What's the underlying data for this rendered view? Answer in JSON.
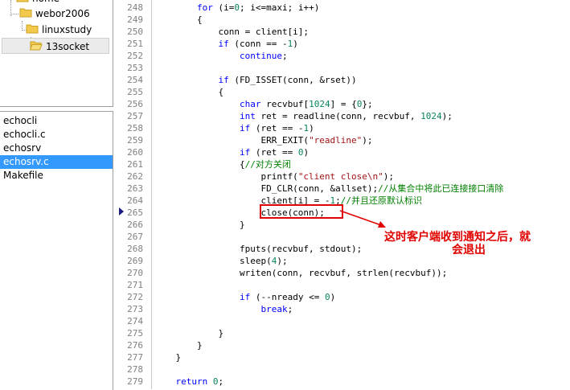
{
  "tree": {
    "items": [
      {
        "label": "home"
      },
      {
        "label": "webor2006"
      },
      {
        "label": "linuxstudy"
      },
      {
        "label": "13socket"
      }
    ]
  },
  "files": [
    {
      "label": "echocli"
    },
    {
      "label": "echocli.c"
    },
    {
      "label": "echosrv"
    },
    {
      "label": "echosrv.c"
    },
    {
      "label": "Makefile"
    }
  ],
  "colors": {
    "annotation": "#e00000",
    "selection": "#3399ff",
    "keyword": "#0000ff",
    "string": "#a31515",
    "comment": "#008000"
  },
  "line_numbers": [
    "248",
    "249",
    "250",
    "251",
    "252",
    "253",
    "254",
    "255",
    "256",
    "257",
    "258",
    "259",
    "260",
    "261",
    "262",
    "263",
    "264",
    "265",
    "266",
    "267",
    "268",
    "269",
    "270",
    "271",
    "272",
    "273",
    "274",
    "275",
    "276",
    "277",
    "278",
    "279"
  ],
  "code": [
    [
      {
        "t": "        "
      },
      {
        "t": "for",
        "c": "kw"
      },
      {
        "t": " (i="
      },
      {
        "t": "0",
        "c": "num"
      },
      {
        "t": "; i<=maxi; i++)"
      }
    ],
    [
      {
        "t": "        {"
      }
    ],
    [
      {
        "t": "            conn = client[i];"
      }
    ],
    [
      {
        "t": "            "
      },
      {
        "t": "if",
        "c": "kw"
      },
      {
        "t": " (conn == -"
      },
      {
        "t": "1",
        "c": "num"
      },
      {
        "t": ")"
      }
    ],
    [
      {
        "t": "                "
      },
      {
        "t": "continue",
        "c": "kw"
      },
      {
        "t": ";"
      }
    ],
    [
      {
        "t": ""
      }
    ],
    [
      {
        "t": "            "
      },
      {
        "t": "if",
        "c": "kw"
      },
      {
        "t": " (FD_ISSET(conn, &rset))"
      }
    ],
    [
      {
        "t": "            {"
      }
    ],
    [
      {
        "t": "                "
      },
      {
        "t": "char",
        "c": "kw"
      },
      {
        "t": " recvbuf["
      },
      {
        "t": "1024",
        "c": "num"
      },
      {
        "t": "] = {"
      },
      {
        "t": "0",
        "c": "num"
      },
      {
        "t": "};"
      }
    ],
    [
      {
        "t": "                "
      },
      {
        "t": "int",
        "c": "kw"
      },
      {
        "t": " ret = readline(conn, recvbuf, "
      },
      {
        "t": "1024",
        "c": "num"
      },
      {
        "t": ");"
      }
    ],
    [
      {
        "t": "                "
      },
      {
        "t": "if",
        "c": "kw"
      },
      {
        "t": " (ret == -"
      },
      {
        "t": "1",
        "c": "num"
      },
      {
        "t": ")"
      }
    ],
    [
      {
        "t": "                    ERR_EXIT("
      },
      {
        "t": "\"readline\"",
        "c": "str"
      },
      {
        "t": ");"
      }
    ],
    [
      {
        "t": "                "
      },
      {
        "t": "if",
        "c": "kw"
      },
      {
        "t": " (ret == "
      },
      {
        "t": "0",
        "c": "num"
      },
      {
        "t": ")"
      }
    ],
    [
      {
        "t": "                {"
      },
      {
        "t": "//对方关闭",
        "c": "cm"
      }
    ],
    [
      {
        "t": "                    printf("
      },
      {
        "t": "\"client close\\n\"",
        "c": "str"
      },
      {
        "t": ");"
      }
    ],
    [
      {
        "t": "                    FD_CLR(conn, &allset);"
      },
      {
        "t": "//从集合中将此已连接接口清除",
        "c": "cm"
      }
    ],
    [
      {
        "t": "                    client[i] = -"
      },
      {
        "t": "1",
        "c": "num"
      },
      {
        "t": ";"
      },
      {
        "t": "//并且还原默认标识",
        "c": "cm"
      }
    ],
    [
      {
        "t": "                    close(conn);"
      }
    ],
    [
      {
        "t": "                }"
      }
    ],
    [
      {
        "t": ""
      }
    ],
    [
      {
        "t": "                fputs(recvbuf, stdout);"
      }
    ],
    [
      {
        "t": "                sleep("
      },
      {
        "t": "4",
        "c": "num"
      },
      {
        "t": ");"
      }
    ],
    [
      {
        "t": "                writen(conn, recvbuf, strlen(recvbuf));"
      }
    ],
    [
      {
        "t": ""
      }
    ],
    [
      {
        "t": "                "
      },
      {
        "t": "if",
        "c": "kw"
      },
      {
        "t": " (--nready <= "
      },
      {
        "t": "0",
        "c": "num"
      },
      {
        "t": ")"
      }
    ],
    [
      {
        "t": "                    "
      },
      {
        "t": "break",
        "c": "kw"
      },
      {
        "t": ";"
      }
    ],
    [
      {
        "t": ""
      }
    ],
    [
      {
        "t": "            }"
      }
    ],
    [
      {
        "t": "        }"
      }
    ],
    [
      {
        "t": "    }"
      }
    ],
    [
      {
        "t": ""
      }
    ],
    [
      {
        "t": "    "
      },
      {
        "t": "return",
        "c": "kw"
      },
      {
        "t": " "
      },
      {
        "t": "0",
        "c": "num"
      },
      {
        "t": ";"
      }
    ]
  ],
  "annotation": {
    "line1": "这时客户端收到通知之后，就",
    "line2": "会退出"
  }
}
